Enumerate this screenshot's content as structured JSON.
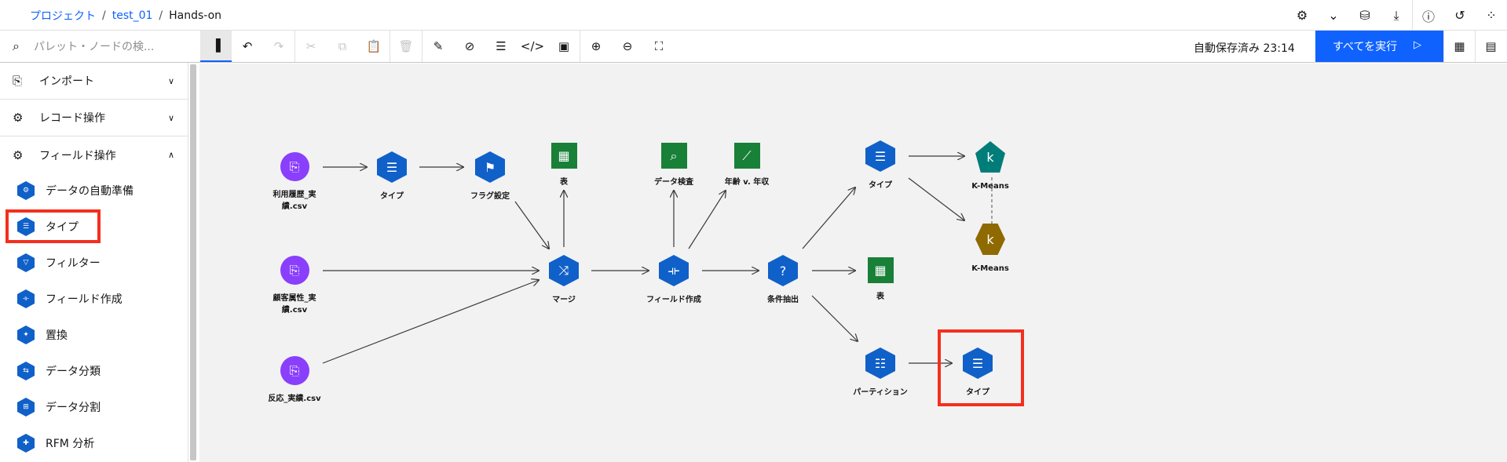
{
  "breadcrumb": {
    "project": "プロジェクト",
    "folder": "test_01",
    "current": "Hands-on"
  },
  "toolbar": {
    "search_placeholder": "パレット・ノードの検...",
    "autosave": "自動保存済み 23:14",
    "run_all": "すべてを実行"
  },
  "sidebar": {
    "categories": [
      {
        "label": "インポート",
        "icon": "import-icon",
        "expanded": false
      },
      {
        "label": "レコード操作",
        "icon": "record-ops-icon",
        "expanded": false
      },
      {
        "label": "フィールド操作",
        "icon": "field-ops-icon",
        "expanded": true
      }
    ],
    "items": [
      {
        "label": "データの自動準備",
        "icon": "auto-data-prep-icon"
      },
      {
        "label": "タイプ",
        "icon": "type-icon"
      },
      {
        "label": "フィルター",
        "icon": "filter-icon"
      },
      {
        "label": "フィールド作成",
        "icon": "derive-icon"
      },
      {
        "label": "置換",
        "icon": "filler-icon"
      },
      {
        "label": "データ分類",
        "icon": "reclassify-icon"
      },
      {
        "label": "データ分割",
        "icon": "binning-icon"
      },
      {
        "label": "RFM 分析",
        "icon": "rfm-icon"
      }
    ]
  },
  "nodes": {
    "n1": "利用履歴_実\n績.csv",
    "n2": "タイプ",
    "n3": "フラグ設定",
    "n4": "表",
    "n5": "顧客属性_実\n績.csv",
    "n6": "マージ",
    "n7": "反応_実績.csv",
    "n8": "データ検査",
    "n9": "年齢 v. 年収",
    "n10": "フィールド作成",
    "n11": "条件抽出",
    "n12": "タイプ",
    "n13": "K-Means",
    "n14": "K-Means",
    "n15": "表",
    "n16": "パーティション",
    "n17": "タイプ"
  },
  "colors": {
    "accent": "#0f62fe",
    "highlight": "#f42f1e",
    "source": "#8a3ffc",
    "output": "#198038",
    "model": "#007d79",
    "nugget": "#8e6a00"
  }
}
